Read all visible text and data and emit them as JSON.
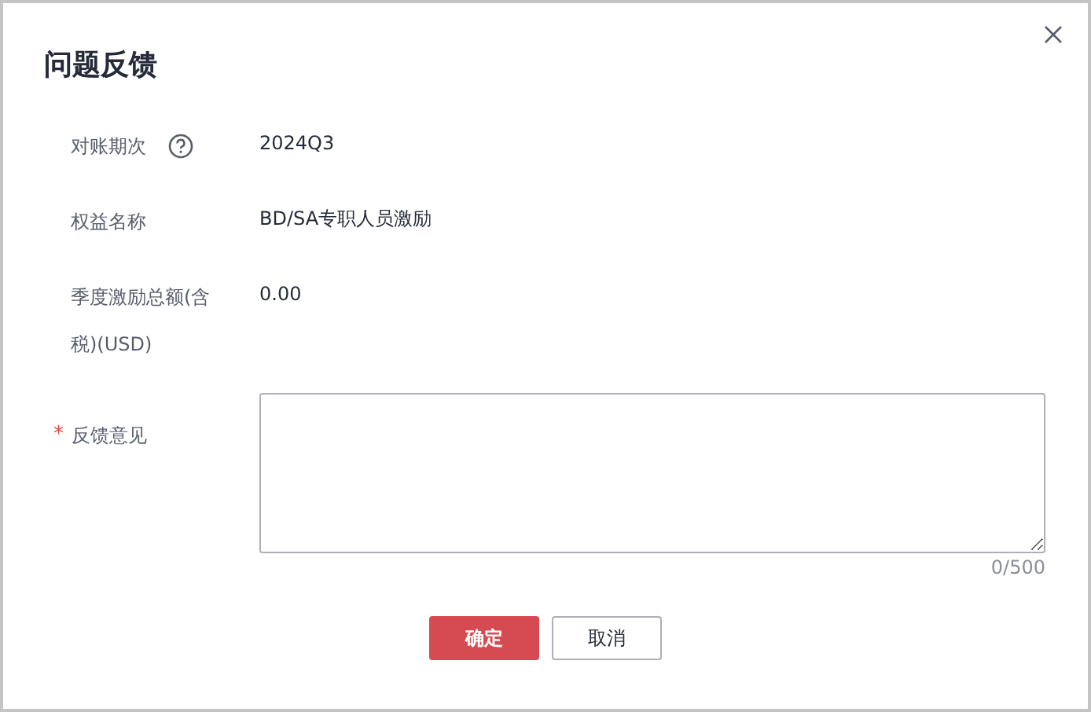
{
  "dialog": {
    "title": "问题反馈"
  },
  "rows": [
    {
      "label": "对账期次",
      "help": true,
      "value": "2024Q3"
    },
    {
      "label": "权益名称",
      "help": false,
      "value": "BD/SA专职人员激励"
    },
    {
      "label": "季度激励总额(含税)(USD)",
      "help": false,
      "value": "0.00"
    }
  ],
  "feedback": {
    "label": "反馈意见",
    "required_mark": "*",
    "counter": "0/500"
  },
  "buttons": [
    {
      "label": "确定",
      "kind": "primary"
    },
    {
      "label": "取消",
      "kind": "secondary"
    }
  ]
}
